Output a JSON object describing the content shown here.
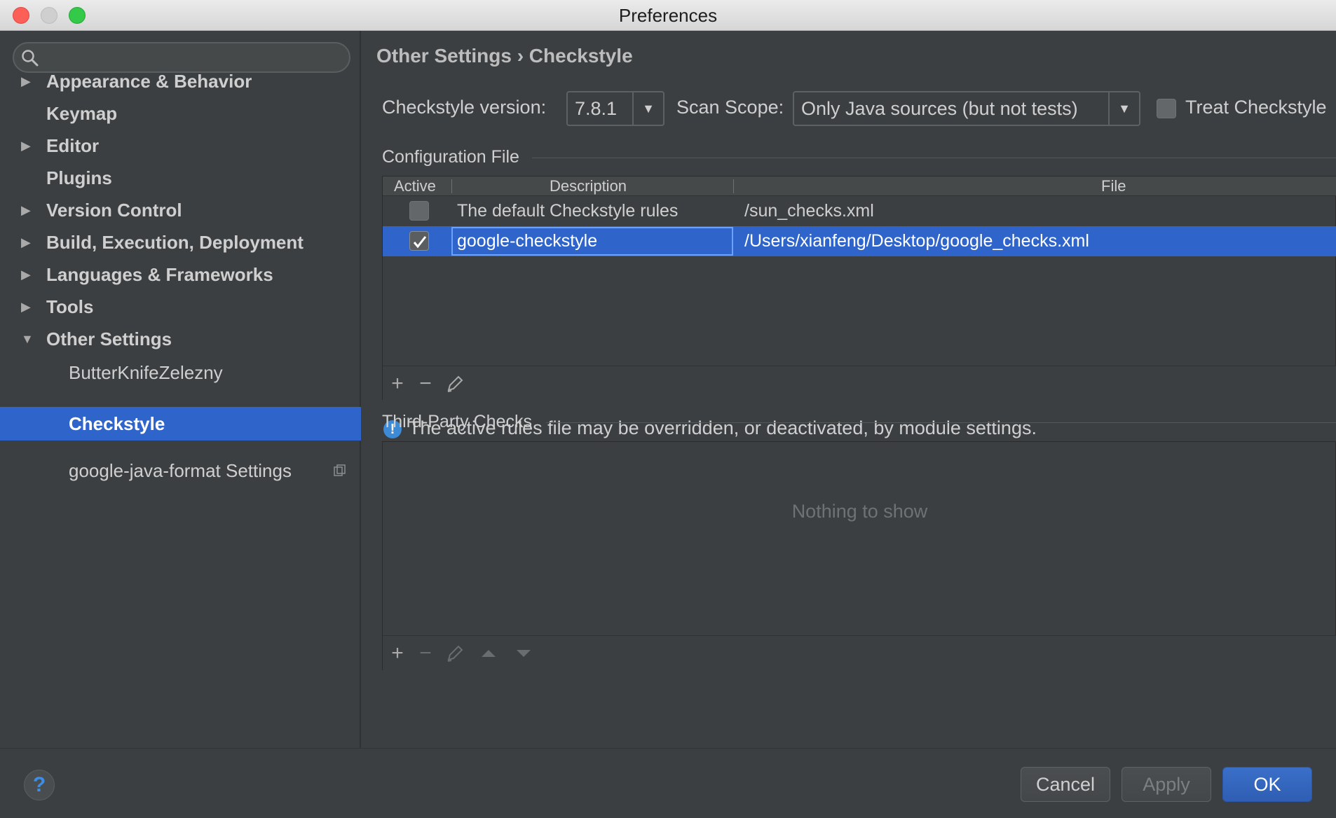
{
  "window": {
    "title": "Preferences"
  },
  "sidebar": {
    "search": {
      "value": "",
      "placeholder": ""
    },
    "items": [
      {
        "label": "Appearance & Behavior",
        "arrow": "▶"
      },
      {
        "label": "Keymap",
        "arrow": ""
      },
      {
        "label": "Editor",
        "arrow": "▶"
      },
      {
        "label": "Plugins",
        "arrow": ""
      },
      {
        "label": "Version Control",
        "arrow": "▶"
      },
      {
        "label": "Build, Execution, Deployment",
        "arrow": "▶"
      },
      {
        "label": "Languages & Frameworks",
        "arrow": "▶"
      },
      {
        "label": "Tools",
        "arrow": "▶"
      },
      {
        "label": "Other Settings",
        "arrow": "▼"
      }
    ],
    "subitems": [
      {
        "label": "ButterKnifeZelezny"
      },
      {
        "label": "Checkstyle",
        "selected": true
      },
      {
        "label": "google-java-format Settings"
      }
    ]
  },
  "main": {
    "breadcrumb": "Other Settings › Checkstyle",
    "checkstyle_version_label": "Checkstyle version:",
    "checkstyle_version": "7.8.1",
    "scan_scope_label": "Scan Scope:",
    "scan_scope": "Only Java sources (but not tests)",
    "treat_label": "Treat Checkstyle",
    "config_group": "Configuration File",
    "table": {
      "headers": [
        "Active",
        "Description",
        "File"
      ],
      "rows": [
        {
          "active": false,
          "description": "The default Checkstyle rules",
          "file": "/sun_checks.xml"
        },
        {
          "active": true,
          "description": "google-checkstyle",
          "file": "/Users/xianfeng/Desktop/google_checks.xml"
        }
      ]
    },
    "info": "The active rules file may be overridden, or deactivated, by module settings.",
    "third_party_group": "Third-Party Checks",
    "third_party_empty": "Nothing to show"
  },
  "buttons": {
    "cancel": "Cancel",
    "apply": "Apply",
    "ok": "OK",
    "help": "?"
  },
  "colors": {
    "accent": "#2f65ca",
    "background": "#3c3f41"
  }
}
